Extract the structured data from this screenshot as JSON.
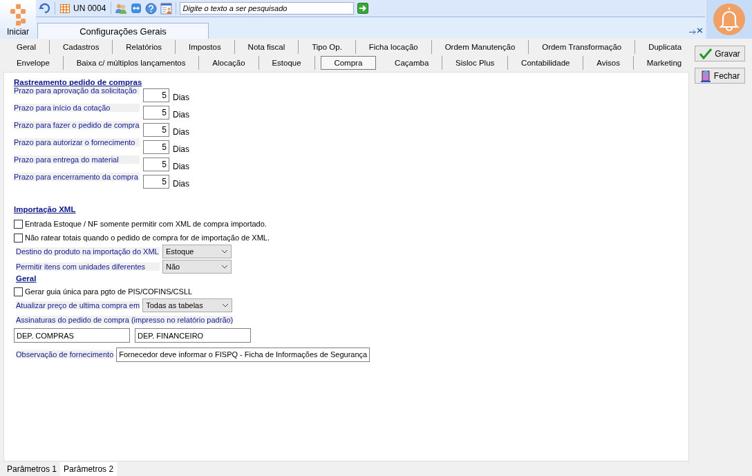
{
  "start_button": {
    "label": "Iniciar"
  },
  "toolbar": {
    "unit": "UN 0004",
    "search": {
      "placeholder": "Digite o texto a ser pesquisado"
    }
  },
  "document_tab": {
    "title": "Configurações Gerais",
    "close": "×"
  },
  "tab_rows": [
    [
      {
        "label": "Geral",
        "selected": false
      },
      {
        "label": "Cadastros",
        "selected": false
      },
      {
        "label": "Relatórios",
        "selected": false
      },
      {
        "label": "Impostos",
        "selected": false
      },
      {
        "label": "Nota fiscal",
        "selected": false
      },
      {
        "label": "Tipo Op.",
        "selected": false
      },
      {
        "label": "Ficha locação",
        "selected": false
      },
      {
        "label": "Ordem Manutenção",
        "selected": false
      },
      {
        "label": "Ordem Transformação",
        "selected": false
      },
      {
        "label": "Duplicata",
        "selected": false
      }
    ],
    [
      {
        "label": "Envelope",
        "selected": false
      },
      {
        "label": "Baixa c/ múltiplos lançamentos",
        "selected": false
      },
      {
        "label": "Alocação",
        "selected": false
      },
      {
        "label": "Estoque",
        "selected": false
      },
      {
        "label": "Compra",
        "selected": true
      },
      {
        "label": "Caçamba",
        "selected": false
      },
      {
        "label": "Sisloc Plus",
        "selected": false
      },
      {
        "label": "Contabilidade",
        "selected": false
      },
      {
        "label": "Avisos",
        "selected": false
      },
      {
        "label": "Marketing",
        "selected": false
      }
    ]
  ],
  "actions": [
    {
      "kind": "save",
      "label": "Gravar"
    },
    {
      "kind": "close",
      "label": "Fechar"
    }
  ],
  "tracking": {
    "heading": "Rastreamento pedido de compras",
    "rows": [
      {
        "label": "Prazo para aprovação da solicitação",
        "value": "5",
        "unit": "Dias"
      },
      {
        "label": "Prazo para início da cotação",
        "value": "5",
        "unit": "Dias"
      },
      {
        "label": "Prazo para fazer o pedido de compra",
        "value": "5",
        "unit": "Dias"
      },
      {
        "label": "Prazo para autorizar o fornecimento",
        "value": "5",
        "unit": "Dias"
      },
      {
        "label": "Prazo para entrega do material",
        "value": "5",
        "unit": "Dias"
      },
      {
        "label": "Prazo para encerramento da compra",
        "value": "5",
        "unit": "Dias"
      }
    ]
  },
  "xml_import": {
    "heading": "Importação XML",
    "items": [
      {
        "kind": "checkbox",
        "label": "Entrada Estoque / NF somente permitir com XML de compra importado.",
        "checked": false
      },
      {
        "kind": "checkbox",
        "label": "Não ratear totais quando o pedido de compra for de importação de XML.",
        "checked": false
      },
      {
        "kind": "select",
        "label": "Destino do produto na importação do XML",
        "value": "Estoque"
      },
      {
        "kind": "select",
        "label": "Permitir itens com unidades diferentes",
        "value": "Não"
      }
    ]
  },
  "general": {
    "heading": "Geral",
    "items": [
      {
        "kind": "checkbox",
        "label": "Gerar guia única para pgto de PIS/COFINS/CSLL",
        "checked": false
      },
      {
        "kind": "select",
        "label": "Atualizar preço de ultima compra em",
        "value": "Todas as tabelas"
      }
    ],
    "signatures_label": "Assinaturas do pedido de compra (impresso no relatório padrão)",
    "signatures": [
      "DEP. COMPRAS",
      "DEP. FINANCEIRO"
    ],
    "supply_note": {
      "label": "Observação de fornecimento",
      "value": "Fornecedor deve informar o FISPQ - Ficha de Informações de Segurança"
    }
  },
  "bottom_tabs": [
    {
      "label": "Parâmetros 1",
      "selected": false
    },
    {
      "label": "Parâmetros 2",
      "selected": true
    }
  ]
}
